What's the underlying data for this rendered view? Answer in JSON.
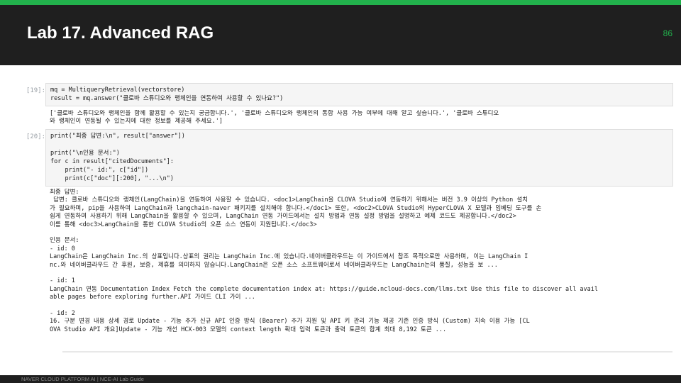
{
  "slide": {
    "title": "Lab 17. Advanced RAG",
    "page_number": "86",
    "footer": "NAVER CLOUD PLATFORM AI  |  NCE-AI Lab Guide",
    "accent_color": "#22b14c",
    "header_color": "#1f1f1f"
  },
  "cells": [
    {
      "prompt": "[19]:",
      "code": [
        "mq = MultiqueryRetrieval(vectorstore)",
        "result = mq.answer(\"클로바 스튜디오와 랭체인을 연동하여 사용할 수 있나요?\")"
      ],
      "output": [
        "['클로바 스튜디오와 랭체인을 함께 활용할 수 있는지 궁금합니다.', '클로바 스튜디오와 랭체인의 통합 사용 가능 여부에 대해 알고 싶습니다.', '클로바 스튜디오",
        "와 랭체인이 연동될 수 있는지에 대한 정보를 제공해 주세요.']"
      ]
    },
    {
      "prompt": "[20]:",
      "code": [
        "print(\"최종 답변:\\n\", result[\"answer\"])",
        "",
        "print(\"\\n인용 문서:\")",
        "for c in result[\"citedDocuments\"]:",
        "    print(\"- id:\", c[\"id\"])",
        "    print(c[\"doc\"][:200], \"...\\n\")"
      ],
      "output": [
        "최종 답변:",
        " 답변: 클로바 스튜디오와 랭체인(LangChain)을 연동하여 사용할 수 있습니다. <doc1>LangChain을 CLOVA Studio에 연동하기 위해서는 버전 3.9 이상의 Python 설치",
        "가 필요하며, pip을 사용하여 LangChain과 langchain-naver 패키지를 설치해야 합니다.</doc1> 또한, <doc2>CLOVA Studio의 HyperCLOVA X 모델과 임베딩 도구를 손",
        "쉽게 연동하여 사용하기 위해 LangChain을 활용할 수 있으며, LangChain 연동 가이드에서는 설치 방법과 연동 설정 방법을 설명하고 예제 코드도 제공합니다.</doc2>",
        "이를 통해 <doc3>LangChain을 통한 CLOVA Studio의 오픈 소스 연동이 지원됩니다.</doc3>",
        "",
        "인용 문서:",
        "- id: 0",
        "LangChain은 LangChain Inc.의 상표입니다.상표의 권리는 LangChain Inc.에 있습니다.네이버클라우드는 이 가이드에서 참조 목적으로만 사용하며, 이는 LangChain I",
        "nc.와 네이버클라우드 간 후원, 보증, 제휴를 의미하지 않습니다.LangChain은 오픈 소스 소프트웨어로서 네이버클라우드는 LangChain는의 품질, 성능을 보 ...",
        "",
        "- id: 1",
        "LangChain 연동 Documentation Index Fetch the complete documentation index at: https://guide.ncloud-docs.com/llms.txt Use this file to discover all avail",
        "able pages before exploring further.API 가이드 CLI 가이 ...",
        "",
        "- id: 2",
        "16. 구분 변경 내용 상세 경로 Update - 기능 추가 신규 API 인증 방식 (Bearer) 추가 지원 및 API 키 관리 기능 제공 기존 인증 방식 (Custom) 지속 이용 가능 [CL",
        "OVA Studio API 개요]Update - 기능 개선 HCX-003 모델의 context length 확대 입력 토큰과 출력 토큰의 합계 최대 8,192 토큰 ..."
      ]
    }
  ]
}
